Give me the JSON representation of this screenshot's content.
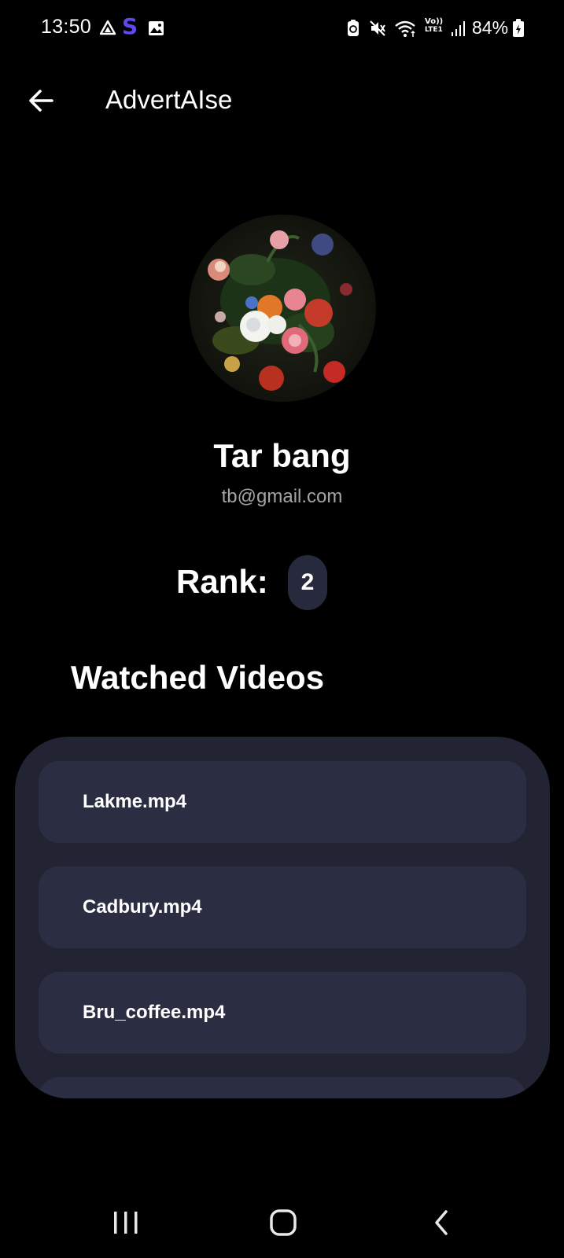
{
  "status_bar": {
    "time": "13:50",
    "battery": "84%",
    "icons": [
      "drive-icon",
      "s-app-icon",
      "gallery-icon",
      "battery-saver-icon",
      "mute-icon",
      "wifi-icon",
      "volte-icon",
      "signal-icon",
      "battery-charging-icon"
    ],
    "s_app_letter": "S",
    "volte_label_top": "Vo))",
    "volte_label_bottom": "LTE1"
  },
  "app_bar": {
    "title": "AdvertAIse",
    "back_icon": "arrow-left-icon"
  },
  "profile": {
    "name": "Tar bang",
    "email": "tb@gmail.com",
    "avatar": "flower-painting-avatar",
    "rank_label": "Rank:",
    "rank_value": "2"
  },
  "watched": {
    "title": "Watched Videos",
    "videos": [
      {
        "name": "Lakme.mp4"
      },
      {
        "name": "Cadbury.mp4"
      },
      {
        "name": "Bru_coffee.mp4"
      },
      {
        "name": ""
      }
    ]
  },
  "nav_bar": {
    "recents_icon": "recents-icon",
    "home_icon": "home-icon",
    "back_icon": "back-chevron-icon"
  },
  "colors": {
    "background": "#000000",
    "panel": "#222433",
    "item": "#2b2e42",
    "rank_badge": "#272a3c",
    "email_text": "#a4a4a8",
    "s_app_accent": "#5d49f0"
  }
}
